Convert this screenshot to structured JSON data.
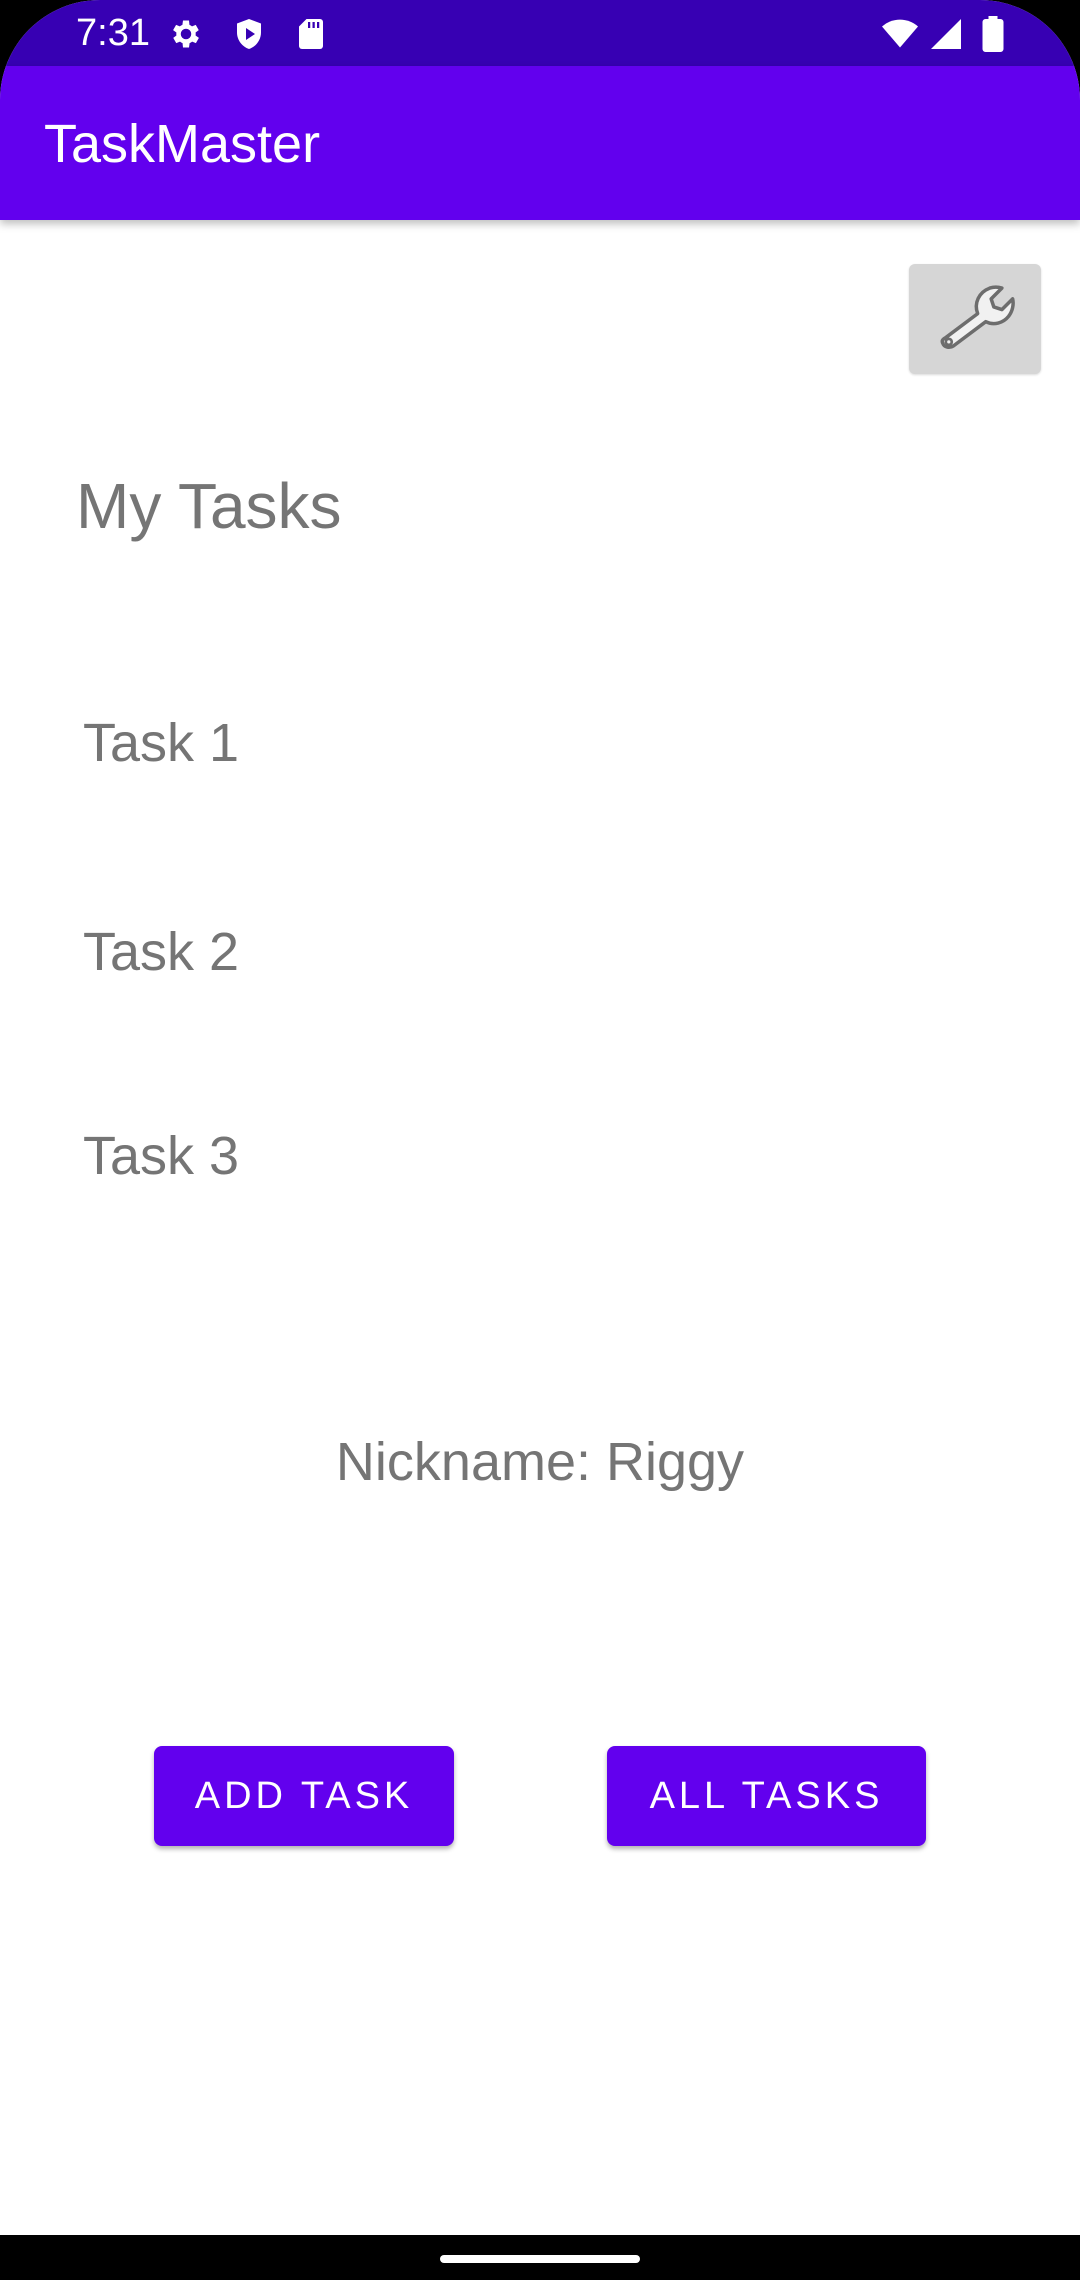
{
  "status_bar": {
    "time": "7:31",
    "icons": [
      "gear-icon",
      "shield-play-icon",
      "sd-card-icon",
      "wifi-icon",
      "signal-icon",
      "battery-icon"
    ]
  },
  "app_bar": {
    "title": "TaskMaster"
  },
  "settings_button": {
    "icon": "wrench-icon"
  },
  "main": {
    "title": "My Tasks",
    "tasks": [
      {
        "label": "Task 1"
      },
      {
        "label": "Task 2"
      },
      {
        "label": "Task 3"
      }
    ],
    "nickname": "Nickname: Riggy"
  },
  "actions": {
    "add_task": "ADD TASK",
    "all_tasks": "ALL TASKS"
  },
  "colors": {
    "status_bar": "#3700b3",
    "primary": "#6200ee",
    "text_secondary": "#757575",
    "settings_button_bg": "#d6d6d6"
  }
}
